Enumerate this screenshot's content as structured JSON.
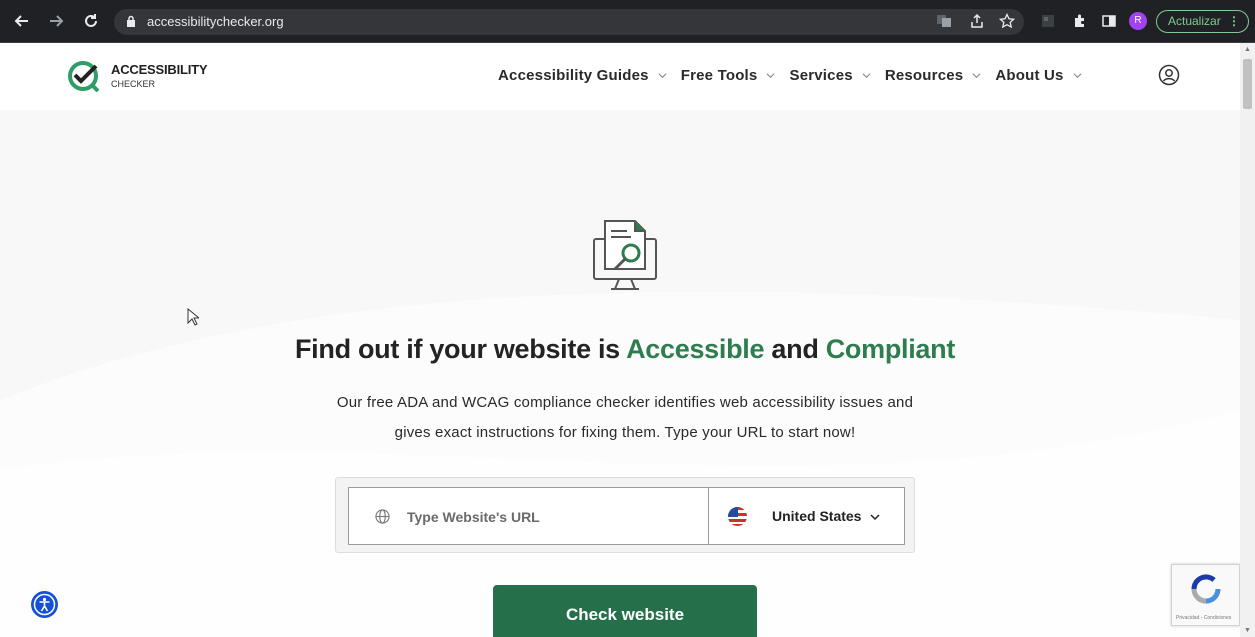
{
  "browser": {
    "url": "accessibilitychecker.org",
    "avatar_letter": "R",
    "update_label": "Actualizar"
  },
  "header": {
    "logo_line1": "ACCESSIBILITY",
    "logo_line2": "CHECKER",
    "nav": [
      {
        "label": "Accessibility Guides"
      },
      {
        "label": "Free Tools"
      },
      {
        "label": "Services"
      },
      {
        "label": "Resources"
      },
      {
        "label": "About Us"
      }
    ]
  },
  "hero": {
    "headline_part1": "Find out if your website is ",
    "headline_green1": "Accessible",
    "headline_part2": " and ",
    "headline_green2": "Compliant",
    "subline1": "Our free ADA and WCAG compliance checker identifies web accessibility issues and",
    "subline2": "gives exact instructions for fixing them. Type your URL to start now!",
    "url_placeholder": "Type Website's URL",
    "country": "United States",
    "button_label": "Check website"
  },
  "recaptcha": {
    "footer_text": "Privacidad - Condiciones"
  },
  "colors": {
    "brand_green": "#2e7d4f",
    "button_green": "#25704a",
    "accessibility_blue": "#1550d8"
  },
  "icons": [
    "back-arrow-icon",
    "forward-arrow-icon",
    "reload-icon",
    "lock-icon",
    "translate-icon",
    "share-icon",
    "star-icon",
    "puzzle-icon",
    "sidebar-icon",
    "more-vert-icon",
    "user-icon",
    "globe-icon",
    "us-flag-icon",
    "chevron-down-icon",
    "accessibility-icon",
    "recaptcha-icon",
    "document-search-icon"
  ]
}
